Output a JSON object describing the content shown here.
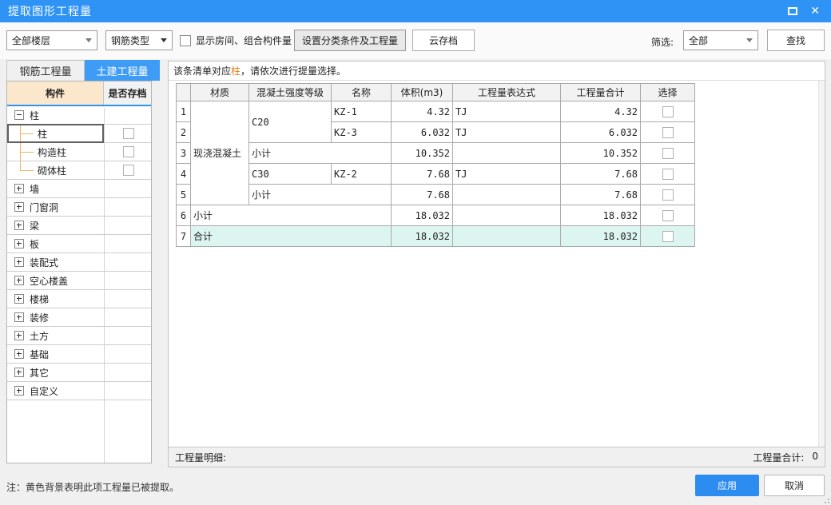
{
  "window": {
    "title": "提取图形工程量"
  },
  "toolbar": {
    "floor_dropdown": "全部楼层",
    "rebar_type_dropdown": "钢筋类型",
    "show_rooms_checkbox_label": "显示房间、组合构件量",
    "set_conditions_button": "设置分类条件及工程量",
    "cloud_archive_button": "云存档",
    "filter_label": "筛选:",
    "filter_dropdown": "全部",
    "find_button": "查找"
  },
  "left_panel": {
    "tabs": [
      {
        "label": "钢筋工程量",
        "active": false
      },
      {
        "label": "土建工程量",
        "active": true
      }
    ],
    "columns": {
      "component": "构件",
      "archived": "是否存档"
    },
    "tree_rows": [
      {
        "type": "parent",
        "label": "柱",
        "expanded": true
      },
      {
        "type": "child",
        "label": "柱",
        "selected": true
      },
      {
        "type": "child",
        "label": "构造柱"
      },
      {
        "type": "child",
        "label": "砌体柱",
        "last": true
      },
      {
        "type": "parent",
        "label": "墙"
      },
      {
        "type": "parent",
        "label": "门窗洞"
      },
      {
        "type": "parent",
        "label": "梁"
      },
      {
        "type": "parent",
        "label": "板"
      },
      {
        "type": "parent",
        "label": "装配式"
      },
      {
        "type": "parent",
        "label": "空心楼盖"
      },
      {
        "type": "parent",
        "label": "楼梯"
      },
      {
        "type": "parent",
        "label": "装修"
      },
      {
        "type": "parent",
        "label": "土方"
      },
      {
        "type": "parent",
        "label": "基础"
      },
      {
        "type": "parent",
        "label": "其它"
      },
      {
        "type": "parent",
        "label": "自定义"
      }
    ]
  },
  "main": {
    "notice": {
      "prefix": "该条清单对应",
      "highlight": "柱",
      "suffix": "，请依次进行提量选择。"
    },
    "table": {
      "columns": [
        "",
        "材质",
        "混凝土强度等级",
        "名称",
        "体积(m3)",
        "工程量表达式",
        "工程量合计",
        "选择"
      ],
      "rows": [
        {
          "num": "1",
          "material": "现浇混凝土",
          "grade": "C20",
          "name": "KZ-1",
          "volume": "4.32",
          "expr": "TJ",
          "total": "4.32"
        },
        {
          "num": "2",
          "name": "KZ-3",
          "volume": "6.032",
          "expr": "TJ",
          "total": "6.032"
        },
        {
          "num": "3",
          "label": "小计",
          "volume": "10.352",
          "expr": "",
          "total": "10.352"
        },
        {
          "num": "4",
          "grade": "C30",
          "name": "KZ-2",
          "volume": "7.68",
          "expr": "TJ",
          "total": "7.68"
        },
        {
          "num": "5",
          "label": "小计",
          "volume": "7.68",
          "expr": "",
          "total": "7.68"
        },
        {
          "num": "6",
          "label": "小计",
          "volume": "18.032",
          "expr": "",
          "total": "18.032"
        },
        {
          "num": "7",
          "label": "合计",
          "volume": "18.032",
          "expr": "",
          "total": "18.032"
        }
      ]
    },
    "footer": {
      "detail_label": "工程量明细:",
      "total_label": "工程量合计:",
      "total_value": "0"
    }
  },
  "bottom": {
    "note": "注：黄色背景表明此项工程量已被提取。",
    "apply_button": "应用",
    "cancel_button": "取消"
  },
  "colors": {
    "titlebar_blue": "#2e93f5",
    "active_tab_blue": "#3e9cf7",
    "component_header_peach": "#fbe7cb",
    "tree_connector_orange": "#f0b468",
    "notice_highlight_orange": "#e87d0d",
    "total_row_cyan": "#ddf5f0",
    "apply_button_blue": "#2d8cf0"
  }
}
